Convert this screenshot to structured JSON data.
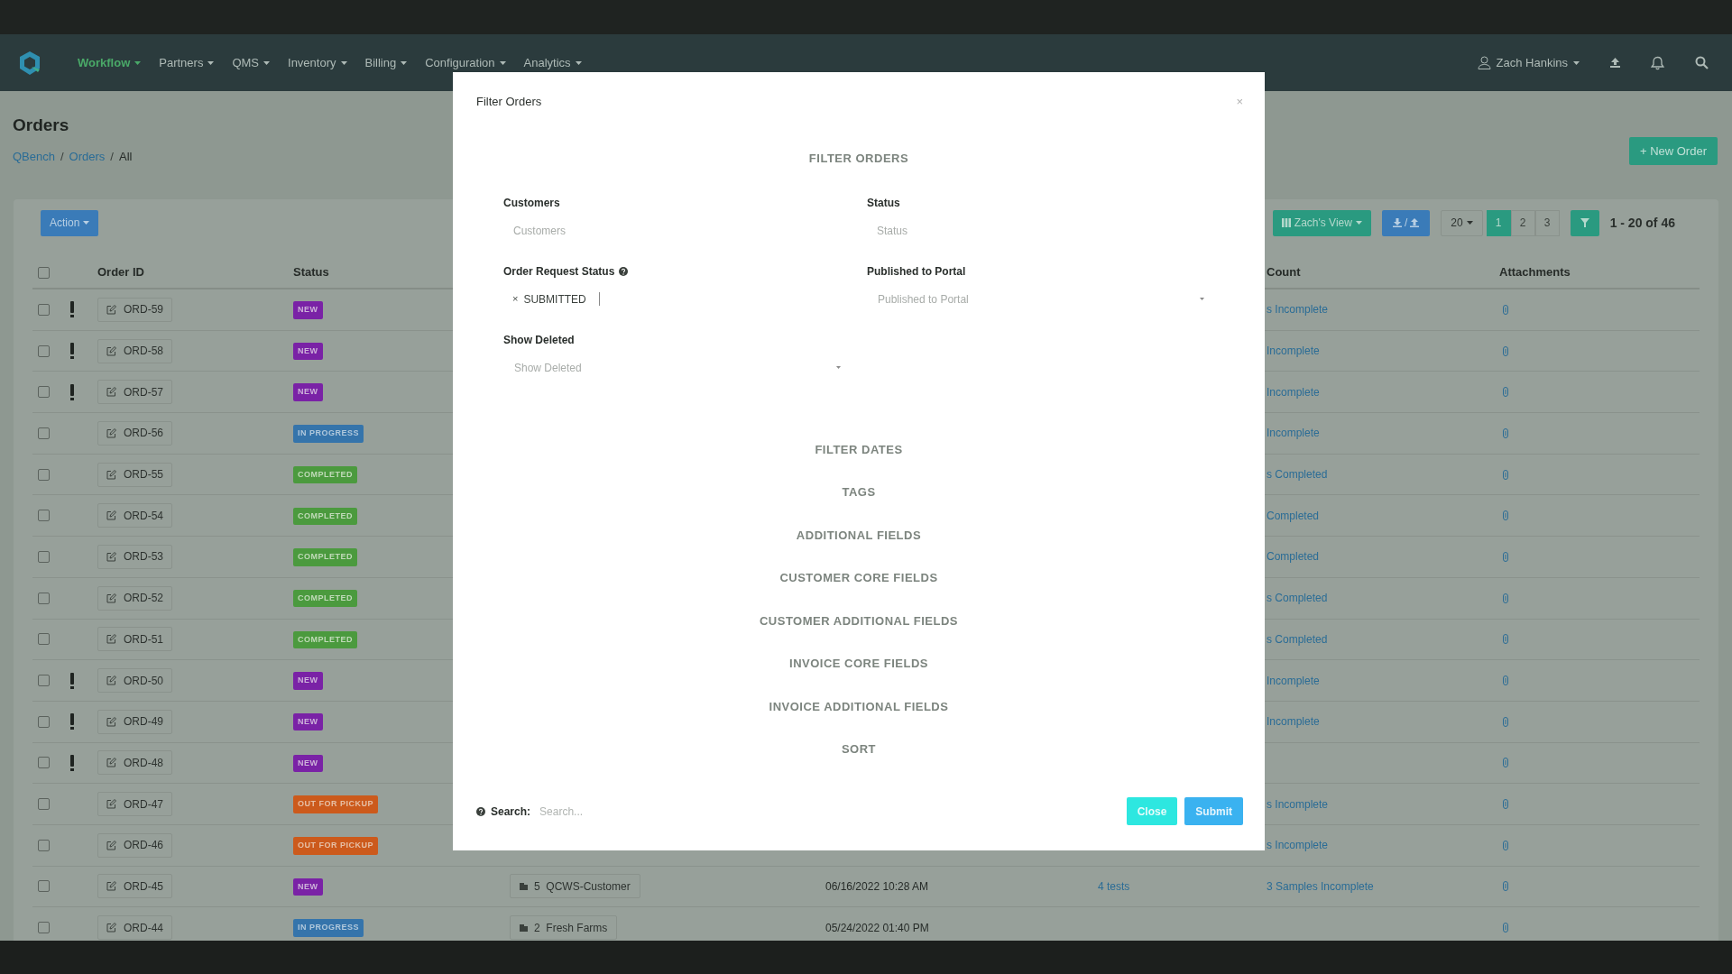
{
  "nav": {
    "items": [
      {
        "label": "Workflow",
        "selected": true
      },
      {
        "label": "Partners",
        "selected": false
      },
      {
        "label": "QMS",
        "selected": false
      },
      {
        "label": "Inventory",
        "selected": false
      },
      {
        "label": "Billing",
        "selected": false
      },
      {
        "label": "Configuration",
        "selected": false
      },
      {
        "label": "Analytics",
        "selected": false
      }
    ],
    "user": "Zach Hankins"
  },
  "page": {
    "title": "Orders",
    "breadcrumb": [
      {
        "text": "QBench",
        "kind": "link"
      },
      {
        "text": "/",
        "kind": "separator"
      },
      {
        "text": "Orders",
        "kind": "link"
      },
      {
        "text": "/",
        "kind": "separator"
      },
      {
        "text": "All",
        "kind": "current"
      }
    ],
    "new_button": "+ New Order"
  },
  "toolbar": {
    "action": "Action",
    "view": "Zach's View",
    "export_separator": "/",
    "page_size": "20",
    "pages": [
      {
        "label": "1",
        "selected": true
      },
      {
        "label": "2",
        "selected": false
      },
      {
        "label": "3",
        "selected": false
      }
    ],
    "range": "1 - 20 of 46"
  },
  "table": {
    "select_all": false,
    "columns": [
      "Order ID",
      "Status",
      "Count",
      "Attachments"
    ],
    "rows": [
      {
        "checked": false,
        "flagged": true,
        "order_id": "ORD-59",
        "status": {
          "label": "NEW",
          "kind": "new"
        },
        "count": "s Incomplete"
      },
      {
        "checked": false,
        "flagged": true,
        "order_id": "ORD-58",
        "status": {
          "label": "NEW",
          "kind": "new"
        },
        "count": "Incomplete"
      },
      {
        "checked": false,
        "flagged": true,
        "order_id": "ORD-57",
        "status": {
          "label": "NEW",
          "kind": "new"
        },
        "count": "Incomplete"
      },
      {
        "checked": false,
        "flagged": false,
        "order_id": "ORD-56",
        "status": {
          "label": "IN PROGRESS",
          "kind": "in_progress"
        },
        "count": "Incomplete"
      },
      {
        "checked": false,
        "flagged": false,
        "order_id": "ORD-55",
        "status": {
          "label": "COMPLETED",
          "kind": "completed"
        },
        "count": "s Completed"
      },
      {
        "checked": false,
        "flagged": false,
        "order_id": "ORD-54",
        "status": {
          "label": "COMPLETED",
          "kind": "completed"
        },
        "count": "Completed"
      },
      {
        "checked": false,
        "flagged": false,
        "order_id": "ORD-53",
        "status": {
          "label": "COMPLETED",
          "kind": "completed"
        },
        "count": "Completed"
      },
      {
        "checked": false,
        "flagged": false,
        "order_id": "ORD-52",
        "status": {
          "label": "COMPLETED",
          "kind": "completed"
        },
        "count": "s Completed"
      },
      {
        "checked": false,
        "flagged": false,
        "order_id": "ORD-51",
        "status": {
          "label": "COMPLETED",
          "kind": "completed"
        },
        "count": "s Completed"
      },
      {
        "checked": false,
        "flagged": true,
        "order_id": "ORD-50",
        "status": {
          "label": "NEW",
          "kind": "new"
        },
        "count": "Incomplete"
      },
      {
        "checked": false,
        "flagged": true,
        "order_id": "ORD-49",
        "status": {
          "label": "NEW",
          "kind": "new"
        },
        "count": "Incomplete"
      },
      {
        "checked": false,
        "flagged": true,
        "order_id": "ORD-48",
        "status": {
          "label": "NEW",
          "kind": "new"
        }
      },
      {
        "checked": false,
        "flagged": false,
        "order_id": "ORD-47",
        "status": {
          "label": "OUT FOR PICKUP",
          "kind": "out_for_pickup"
        },
        "count": "s Incomplete"
      },
      {
        "checked": false,
        "flagged": false,
        "order_id": "ORD-46",
        "status": {
          "label": "OUT FOR PICKUP",
          "kind": "out_for_pickup"
        },
        "count": "s Incomplete"
      },
      {
        "checked": false,
        "flagged": false,
        "order_id": "ORD-45",
        "status": {
          "label": "NEW",
          "kind": "new"
        },
        "customer": "5  QCWS-Customer",
        "date": "06/16/2022 10:28 AM",
        "tests": "4 tests",
        "count": "3 Samples Incomplete"
      },
      {
        "checked": false,
        "flagged": false,
        "order_id": "ORD-44",
        "status": {
          "label": "IN PROGRESS",
          "kind": "in_progress"
        },
        "customer": "2  Fresh Farms",
        "date": "05/24/2022 01:40 PM"
      }
    ]
  },
  "modal": {
    "title": "Filter Orders",
    "close_icon": "×",
    "heading": "FILTER ORDERS",
    "fields": [
      {
        "label": "Customers",
        "kind": "text",
        "placeholder": "Customers"
      },
      {
        "label": "Status",
        "kind": "text",
        "placeholder": "Status"
      },
      {
        "label": "Order Request Status",
        "kind": "tags",
        "help": true,
        "tags": [
          {
            "remove": "×",
            "label": "SUBMITTED"
          }
        ]
      },
      {
        "label": "Published to Portal",
        "kind": "select",
        "placeholder": "Published to Portal"
      },
      {
        "label": "Show Deleted",
        "kind": "select",
        "placeholder": "Show Deleted"
      }
    ],
    "sections": [
      "FILTER DATES",
      "TAGS",
      "ADDITIONAL FIELDS",
      "CUSTOMER CORE FIELDS",
      "CUSTOMER ADDITIONAL FIELDS",
      "INVOICE CORE FIELDS",
      "INVOICE ADDITIONAL FIELDS",
      "SORT"
    ],
    "search": {
      "label": "Search:",
      "placeholder": "Search..."
    },
    "buttons": [
      {
        "label": "Close",
        "kind": "close"
      },
      {
        "label": "Submit",
        "kind": "submit"
      }
    ]
  }
}
